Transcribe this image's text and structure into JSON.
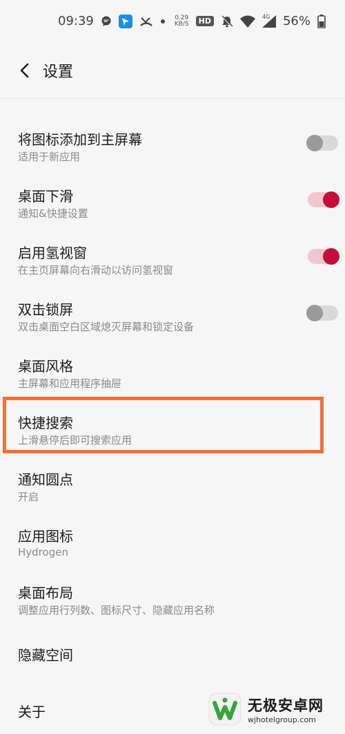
{
  "status_bar": {
    "time": "09:39",
    "speed_value": "0.29",
    "speed_unit": "KB/S",
    "hd_label": "HD",
    "network_type": "4G",
    "battery_percent": "56%"
  },
  "header": {
    "title": "设置"
  },
  "settings": [
    {
      "title": "将图标添加到主屏幕",
      "subtitle": "适用于新应用",
      "toggle": "off"
    },
    {
      "title": "桌面下滑",
      "subtitle": "通知&快捷设置",
      "toggle": "on"
    },
    {
      "title": "启用氢视窗",
      "subtitle": "在主页屏幕向右滑动以访问氢视窗",
      "toggle": "on"
    },
    {
      "title": "双击锁屏",
      "subtitle": "双击桌面空白区域熄灭屏幕和锁定设备",
      "toggle": "off"
    },
    {
      "title": "桌面风格",
      "subtitle": "主屏幕和应用程序抽屉"
    },
    {
      "title": "快捷搜索",
      "subtitle": "上滑悬停后即可搜索应用"
    },
    {
      "title": "通知圆点",
      "subtitle": "开启"
    },
    {
      "title": "应用图标",
      "subtitle": "Hydrogen"
    },
    {
      "title": "桌面布局",
      "subtitle": "调整应用行列数、图标尺寸、隐藏应用名称"
    },
    {
      "title": "隐藏空间"
    },
    {
      "title": "关于"
    }
  ],
  "colors": {
    "toggle_on": "#c2103a",
    "highlight": "#ee7238"
  },
  "watermark": {
    "name": "无极安卓网",
    "url": "wjhotelgroup.com"
  }
}
